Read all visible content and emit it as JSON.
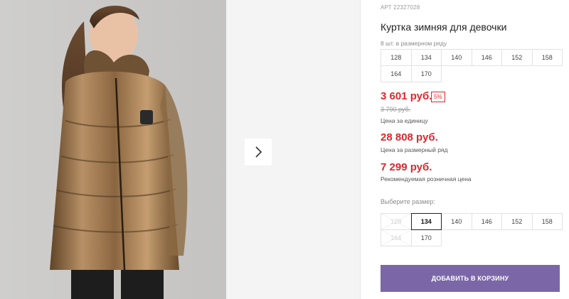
{
  "product": {
    "article": "АРТ 22327028",
    "title": "Куртка зимняя для девочки",
    "pack_note": "8 шт. в размерном ряду",
    "pack_sizes": [
      "128",
      "134",
      "140",
      "146",
      "152",
      "158",
      "164",
      "170"
    ]
  },
  "pricing": {
    "unit_price": "3 601 руб.",
    "discount_badge": "5%",
    "old_price": "3 790 руб.",
    "unit_caption": "Цена за единицу",
    "row_price": "28 808 руб.",
    "row_caption": "Цена за размерный ряд",
    "rrp_price": "7 299 руб.",
    "rrp_caption": "Рекомендуемая розничная цена"
  },
  "size_select": {
    "label": "Выберите размер:",
    "sizes": [
      {
        "label": "128",
        "state": "disabled"
      },
      {
        "label": "134",
        "state": "selected"
      },
      {
        "label": "140",
        "state": "available"
      },
      {
        "label": "146",
        "state": "available"
      },
      {
        "label": "152",
        "state": "available"
      },
      {
        "label": "158",
        "state": "available"
      },
      {
        "label": "164",
        "state": "disabled"
      },
      {
        "label": "170",
        "state": "available"
      }
    ]
  },
  "cart": {
    "add_label": "ДОБАВИТЬ В КОРЗИНУ"
  },
  "gallery": {
    "next_icon": "chevron-right-icon"
  },
  "colors": {
    "price": "#e0262c",
    "button": "#7b67a8",
    "jacket": "#9a7448"
  }
}
